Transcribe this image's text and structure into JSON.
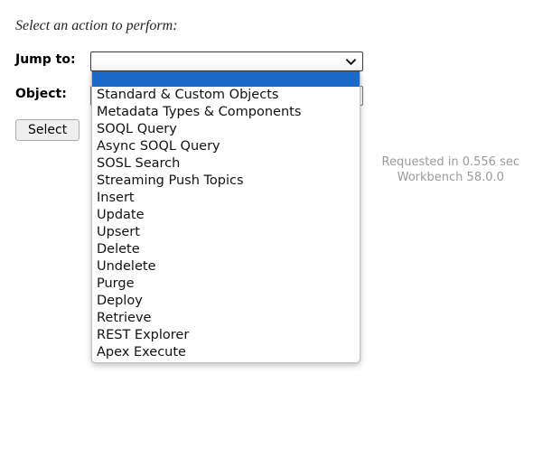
{
  "heading": "Select an action to perform:",
  "form": {
    "jump_to_label": "Jump to:",
    "object_label": "Object:",
    "select_button_label": "Select",
    "jump_to_value": "",
    "object_value": "",
    "object_placeholder": ""
  },
  "icons": {
    "chevron_down": "chevron-down-icon"
  },
  "dropdown": {
    "expanded": true,
    "selected_index": 0,
    "options": [
      "",
      "Standard & Custom Objects",
      "Metadata Types & Components",
      "SOQL Query",
      "Async SOQL Query",
      "SOSL Search",
      "Streaming Push Topics",
      "Insert",
      "Update",
      "Upsert",
      "Delete",
      "Undelete",
      "Purge",
      "Deploy",
      "Retrieve",
      "REST Explorer",
      "Apex Execute"
    ]
  },
  "status": {
    "request_time": "Requested in 0.556 sec",
    "app_version": "Workbench 58.0.0"
  },
  "colors": {
    "highlight_blue": "#1b6ac9",
    "status_gray": "#9a9a9a",
    "button_face": "#efefef",
    "page_background": "#ffffff"
  }
}
